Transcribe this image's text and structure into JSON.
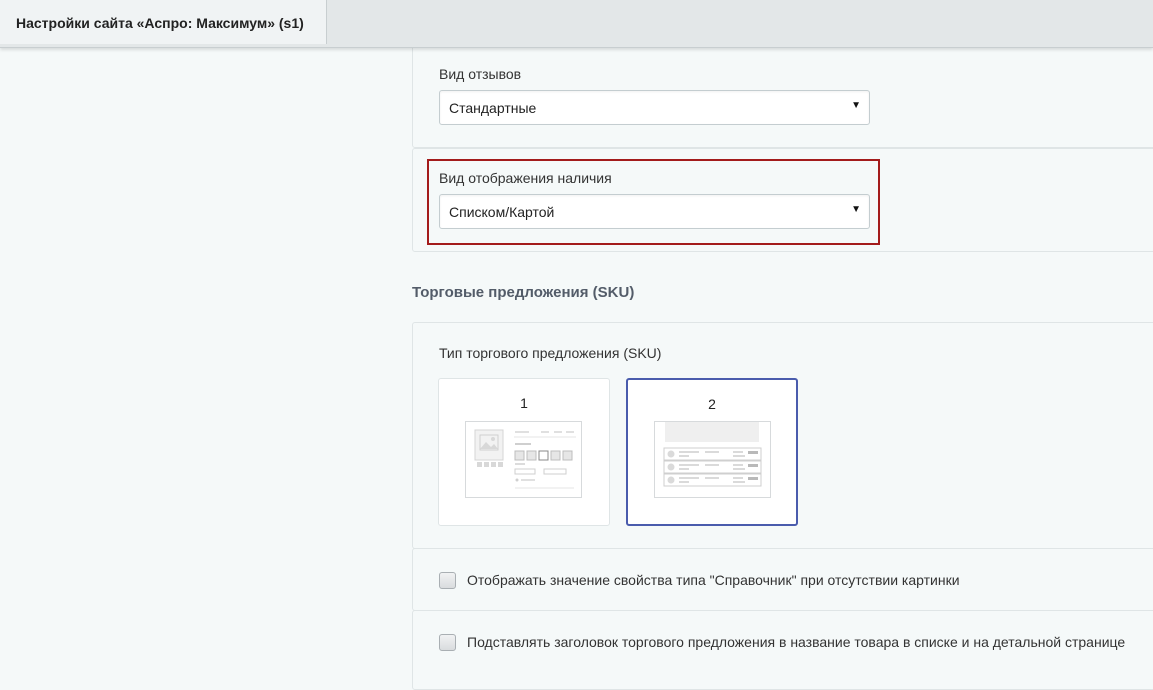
{
  "window": {
    "tab_title": "Настройки сайта «Аспро: Максимум» (s1)"
  },
  "review_view": {
    "label": "Вид отзывов",
    "value": "Стандартные"
  },
  "stock_view": {
    "label": "Вид отображения наличия",
    "value": "Списком/Картой"
  },
  "sku_section": {
    "title": "Торговые предложения (SKU)",
    "type_label": "Тип торгового предложения (SKU)",
    "options": [
      {
        "label": "1",
        "selected": false
      },
      {
        "label": "2",
        "selected": true
      }
    ],
    "selected_color": "#4a5cad"
  },
  "checkboxes": [
    {
      "label": "Отображать значение свойства типа \"Справочник\" при отсутствии картинки",
      "checked": false
    },
    {
      "label": "Подставлять заголовок торгового предложения в название товара в списке и на детальной странице",
      "checked": false
    }
  ],
  "colors": {
    "highlight_border": "#a31b1b",
    "section_title": "#535c69"
  },
  "icons": {
    "select_caret": "▼"
  }
}
